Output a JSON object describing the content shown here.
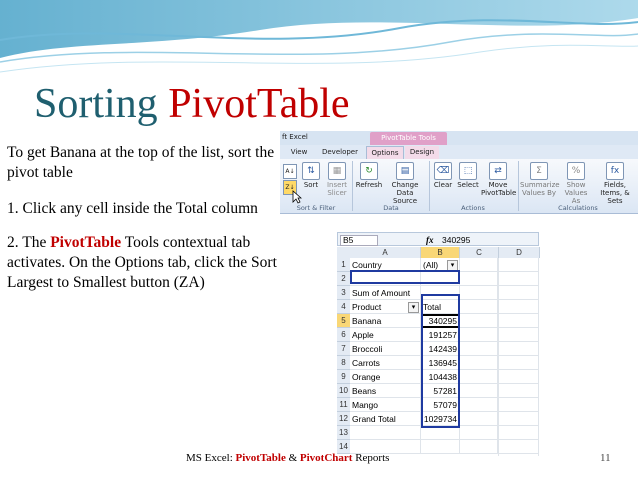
{
  "slide": {
    "title_plain": "Sorting ",
    "title_highlight": "PivotTable",
    "intro": "To get Banana at the top of the list, sort the pivot table",
    "step1": "1.  Click any cell inside the Total column",
    "step2_prefix": "2. The ",
    "step2_highlight": "PivotTable",
    "step2_suffix": " Tools contextual tab activates. On the Options tab, click the Sort Largest to Smallest button (ZA)",
    "footer_prefix": "MS Excel: ",
    "footer_pt": "PivotTable",
    "footer_mid": " & ",
    "footer_pc": "PivotChart",
    "footer_suffix": " Reports",
    "page_number": "11"
  },
  "ribbon": {
    "app_title": "ft Excel",
    "context_label": "PivotTable Tools",
    "tabs": [
      "View",
      "Developer",
      "Options",
      "Design"
    ],
    "active_tab": "Options",
    "buttons": {
      "sort": "Sort",
      "insert_slicer": "Insert Slicer",
      "refresh": "Refresh",
      "change_data_source": "Change Data Source",
      "clear": "Clear",
      "select": "Select",
      "move_pivottable": "Move PivotTable",
      "summarize_values_by": "Summarize Values By",
      "show_values_as": "Show Values As",
      "fields_items_sets": "Fields, Items, & Sets"
    },
    "groups": {
      "sort_filter": "Sort & Filter",
      "data": "Data",
      "actions": "Actions",
      "calculations": "Calculations"
    }
  },
  "sheet": {
    "name_box": "B5",
    "fx_label": "fx",
    "formula_value": "340295",
    "columns": [
      "A",
      "B",
      "C",
      "D"
    ],
    "rows": [
      {
        "n": "1",
        "a": "Country",
        "b": "(All)"
      },
      {
        "n": "2",
        "a": "",
        "b": ""
      },
      {
        "n": "3",
        "a": "Sum of Amount",
        "b": ""
      },
      {
        "n": "4",
        "a": "Product",
        "b": "Total"
      },
      {
        "n": "5",
        "a": "Banana",
        "b": "340295"
      },
      {
        "n": "6",
        "a": "Apple",
        "b": "191257"
      },
      {
        "n": "7",
        "a": "Broccoli",
        "b": "142439"
      },
      {
        "n": "8",
        "a": "Carrots",
        "b": "136945"
      },
      {
        "n": "9",
        "a": "Orange",
        "b": "104438"
      },
      {
        "n": "10",
        "a": "Beans",
        "b": "57281"
      },
      {
        "n": "11",
        "a": "Mango",
        "b": "57079"
      },
      {
        "n": "12",
        "a": "Grand Total",
        "b": "1029734"
      },
      {
        "n": "13",
        "a": "",
        "b": ""
      },
      {
        "n": "14",
        "a": "",
        "b": ""
      }
    ]
  },
  "colors": {
    "title": "#1f5f6f",
    "highlight": "#c00000",
    "pivot_border": "#1f3aa0"
  }
}
